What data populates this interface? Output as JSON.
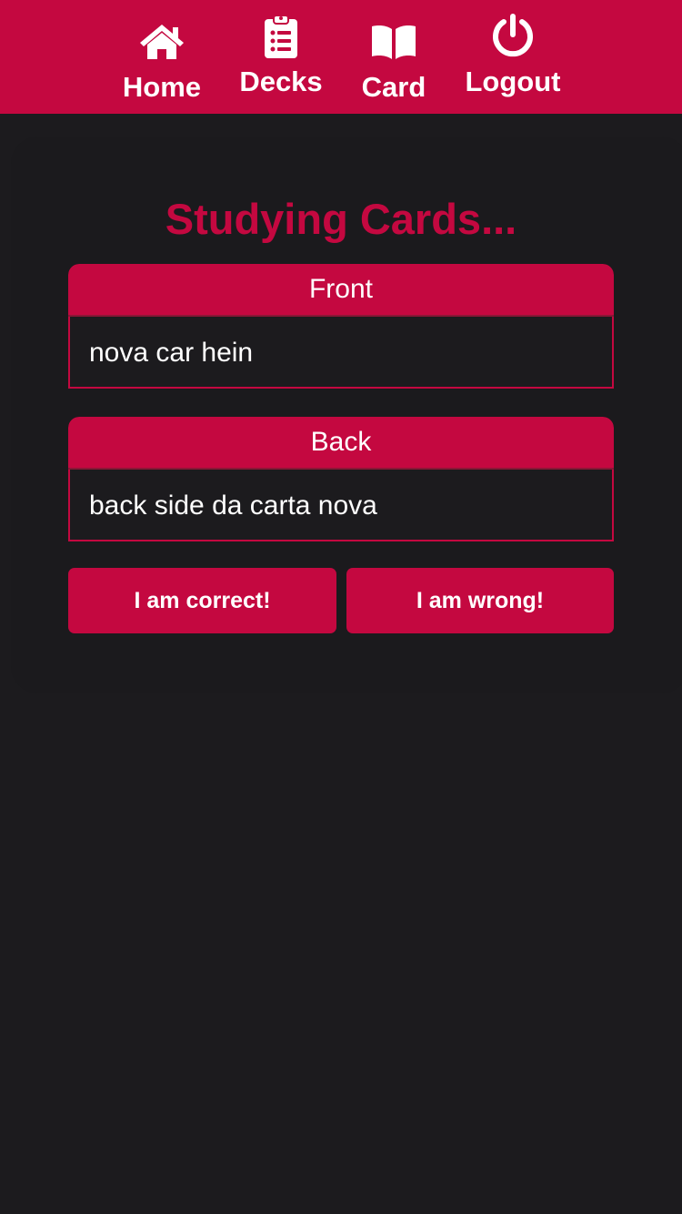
{
  "nav": {
    "items": [
      {
        "label": "Home",
        "icon": "home-icon"
      },
      {
        "label": "Decks",
        "icon": "clipboard-list-icon"
      },
      {
        "label": "Card",
        "icon": "book-open-icon"
      },
      {
        "label": "Logout",
        "icon": "power-icon"
      }
    ]
  },
  "page": {
    "title": "Studying Cards..."
  },
  "cards": {
    "front": {
      "header": "Front",
      "content": "nova car hein"
    },
    "back": {
      "header": "Back",
      "content": "back side da carta nova"
    }
  },
  "actions": {
    "correct_label": "I am correct!",
    "wrong_label": "I am wrong!"
  },
  "colors": {
    "accent": "#c40840",
    "background": "#1c1b1e",
    "text": "#ffffff"
  }
}
